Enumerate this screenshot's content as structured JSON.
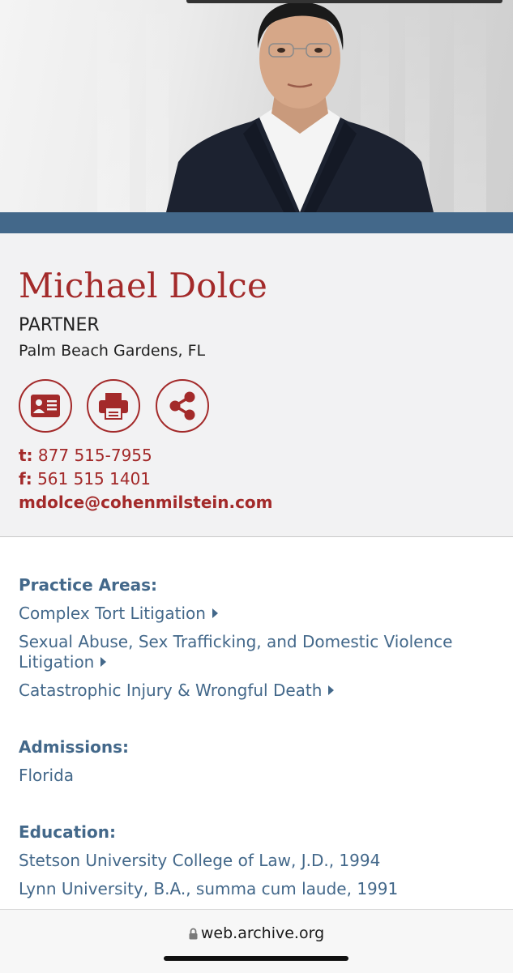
{
  "profile": {
    "name": "Michael Dolce",
    "title": "PARTNER",
    "location": "Palm Beach Gardens, FL"
  },
  "actions": {
    "vcard_icon": "contact-card-icon",
    "print_icon": "printer-icon",
    "share_icon": "share-icon"
  },
  "contact": {
    "phone_label": "t:",
    "phone": "877 515-7955",
    "fax_label": "f:",
    "fax": "561 515 1401",
    "email": "mdolce@cohenmilstein.com"
  },
  "practice_areas": {
    "heading": "Practice Areas:",
    "items": [
      "Complex Tort Litigation",
      "Sexual Abuse, Sex Trafficking, and Domestic Violence Litigation",
      "Catastrophic Injury & Wrongful Death"
    ]
  },
  "admissions": {
    "heading": "Admissions:",
    "items": [
      "Florida"
    ]
  },
  "education": {
    "heading": "Education:",
    "items": [
      "Stetson University College of Law, J.D., 1994",
      "Lynn University, B.A., summa cum laude, 1991"
    ]
  },
  "browser": {
    "url": "web.archive.org"
  },
  "colors": {
    "accent_red": "#a32a2a",
    "accent_blue": "#43688a"
  }
}
